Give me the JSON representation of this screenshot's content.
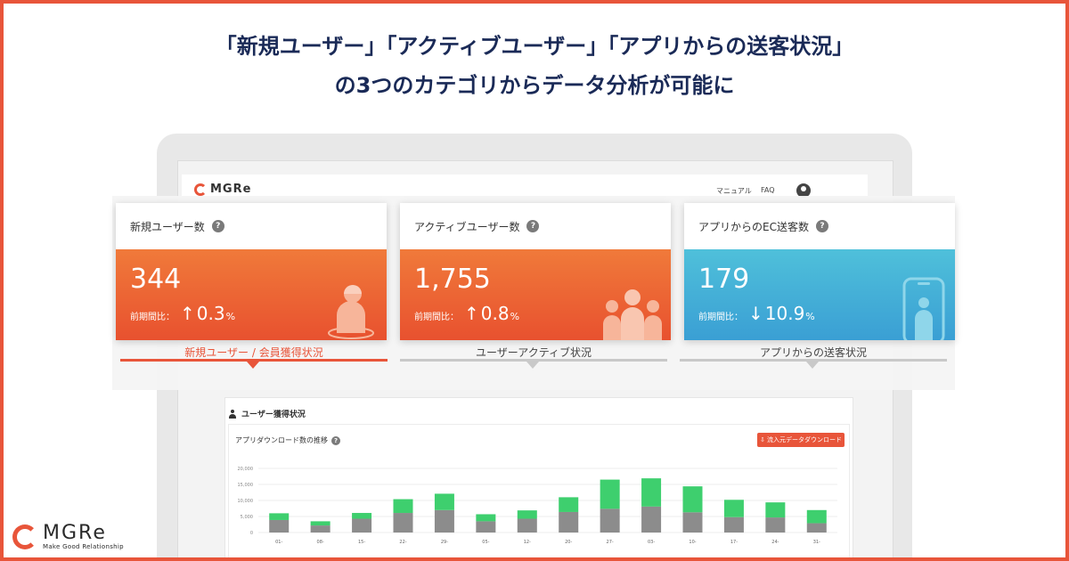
{
  "headline": {
    "line1": "「新規ユーザー」「アクティブユーザー」「アプリからの送客状況」",
    "line2": "の3つのカテゴリからデータ分析が可能に"
  },
  "appbar": {
    "logo": "MGRe",
    "manual": "マニュアル",
    "faq": "FAQ"
  },
  "cards": [
    {
      "title": "新規ユーザー数",
      "value": "344",
      "compare_label": "前期間比：",
      "direction": "up",
      "arrow": "↑",
      "pct": "0.3",
      "unit": "%",
      "color": "#e8512f",
      "icon": "person-icon"
    },
    {
      "title": "アクティブユーザー数",
      "value": "1,755",
      "compare_label": "前期間比：",
      "direction": "up",
      "arrow": "↑",
      "pct": "0.8",
      "unit": "%",
      "color": "#e8512f",
      "icon": "group-icon"
    },
    {
      "title": "アプリからのEC送客数",
      "value": "179",
      "compare_label": "前期間比：",
      "direction": "down",
      "arrow": "↓",
      "pct": "10.9",
      "unit": "%",
      "color": "#3a9fd4",
      "icon": "smartphone-icon"
    }
  ],
  "tabs": [
    {
      "label": "新規ユーザー / 会員獲得状況",
      "active": true
    },
    {
      "label": "ユーザーアクティブ状況",
      "active": false
    },
    {
      "label": "アプリからの送客状況",
      "active": false
    }
  ],
  "section": {
    "title": "ユーザー獲得状況",
    "chart_title": "アプリダウンロード数の推移",
    "download_label": "流入元データダウンロード"
  },
  "chart_data": {
    "type": "bar",
    "stacked": true,
    "categories": [
      "01",
      "08",
      "15",
      "22",
      "29",
      "05",
      "12",
      "20",
      "27",
      "03",
      "10",
      "17",
      "24",
      "31"
    ],
    "yticks": [
      "20,000",
      "15,000",
      "10,000",
      "5,000",
      "0"
    ],
    "ylim": [
      0,
      20000
    ],
    "series": [
      {
        "color": "#8c8c8c",
        "values": [
          3900,
          2200,
          4300,
          6100,
          7000,
          3500,
          4300,
          6400,
          7400,
          8100,
          6300,
          4800,
          4700,
          2900
        ]
      },
      {
        "color": "#3ecf6e",
        "values": [
          2100,
          1300,
          1800,
          4300,
          5100,
          2200,
          2600,
          4600,
          9100,
          8800,
          8100,
          5400,
          4700,
          4100
        ]
      }
    ],
    "grid": true
  },
  "brand": {
    "name": "MGRe",
    "sub": "Make Good Relationship"
  },
  "colors": {
    "accent": "#e8553a",
    "navy": "#1a2a57",
    "blue": "#3a9fd4",
    "green": "#3ecf6e"
  }
}
